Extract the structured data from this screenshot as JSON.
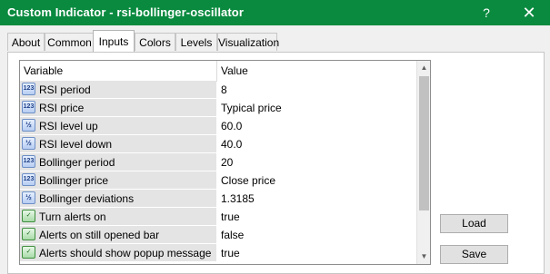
{
  "window": {
    "title": "Custom Indicator - rsi-bollinger-oscillator",
    "help_glyph": "?",
    "close_glyph": "✕"
  },
  "tabs": [
    {
      "label": "About",
      "active": false
    },
    {
      "label": "Common",
      "active": false
    },
    {
      "label": "Inputs",
      "active": true
    },
    {
      "label": "Colors",
      "active": false
    },
    {
      "label": "Levels",
      "active": false
    },
    {
      "label": "Visualization",
      "active": false
    }
  ],
  "grid": {
    "columns": [
      "Variable",
      "Value"
    ],
    "rows": [
      {
        "icon": "integer-icon",
        "icon_text": "123",
        "variable": "RSI period",
        "value": "8"
      },
      {
        "icon": "enum-icon",
        "icon_text": "123",
        "variable": "RSI price",
        "value": "Typical price"
      },
      {
        "icon": "double-icon",
        "icon_text": "½",
        "variable": "RSI level up",
        "value": "60.0"
      },
      {
        "icon": "double-icon",
        "icon_text": "½",
        "variable": "RSI level down",
        "value": "40.0"
      },
      {
        "icon": "integer-icon",
        "icon_text": "123",
        "variable": "Bollinger period",
        "value": "20"
      },
      {
        "icon": "enum-icon",
        "icon_text": "123",
        "variable": "Bollinger price",
        "value": "Close price"
      },
      {
        "icon": "double-icon",
        "icon_text": "½",
        "variable": "Bollinger deviations",
        "value": "1.3185"
      },
      {
        "icon": "bool-icon",
        "icon_text": "✓",
        "variable": "Turn alerts on",
        "value": "true"
      },
      {
        "icon": "bool-icon",
        "icon_text": "✓",
        "variable": "Alerts on still opened bar",
        "value": "false"
      },
      {
        "icon": "bool-icon",
        "icon_text": "✓",
        "variable": "Alerts should show popup message",
        "value": "true"
      }
    ]
  },
  "buttons": {
    "load": "Load",
    "save": "Save"
  },
  "colors": {
    "titlebar": "#0a8a3f"
  }
}
